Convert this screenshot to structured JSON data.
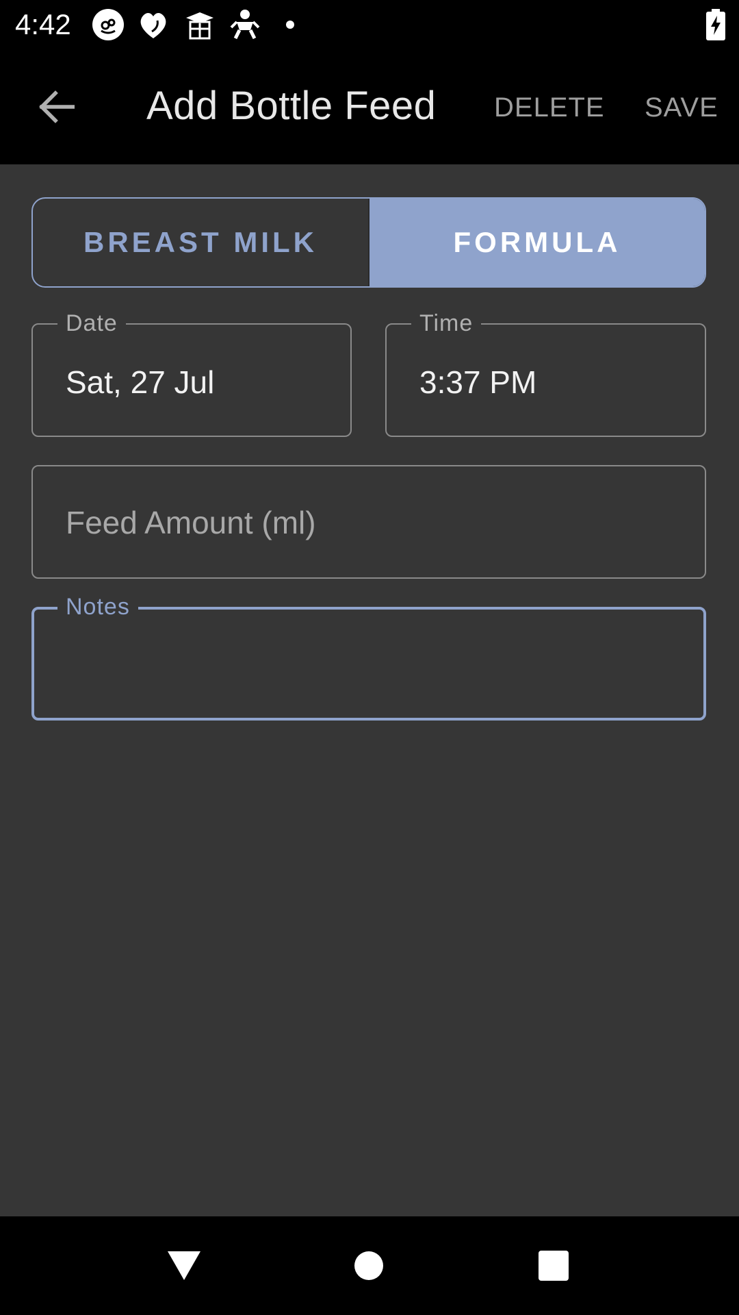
{
  "status_bar": {
    "time": "4:42",
    "icons": [
      "baby-face-icon",
      "heart-pacifier-icon",
      "graduation-cap-icon",
      "baby-figure-icon",
      "dot-icon",
      "battery-charging-icon"
    ]
  },
  "app_bar": {
    "title": "Add Bottle Feed",
    "delete_label": "DELETE",
    "save_label": "SAVE"
  },
  "toggle": {
    "options": [
      "BREAST MILK",
      "FORMULA"
    ],
    "selected": "FORMULA"
  },
  "form": {
    "date": {
      "label": "Date",
      "value": "Sat, 27 Jul"
    },
    "time": {
      "label": "Time",
      "value": "3:37 PM"
    },
    "amount": {
      "placeholder": "Feed Amount (ml)"
    },
    "notes": {
      "label": "Notes",
      "value": ""
    }
  },
  "colors": {
    "accent": "#8fa3cc",
    "background": "#363636",
    "bar": "#000000"
  },
  "nav": [
    "back-triangle-icon",
    "home-circle-icon",
    "recents-square-icon"
  ]
}
